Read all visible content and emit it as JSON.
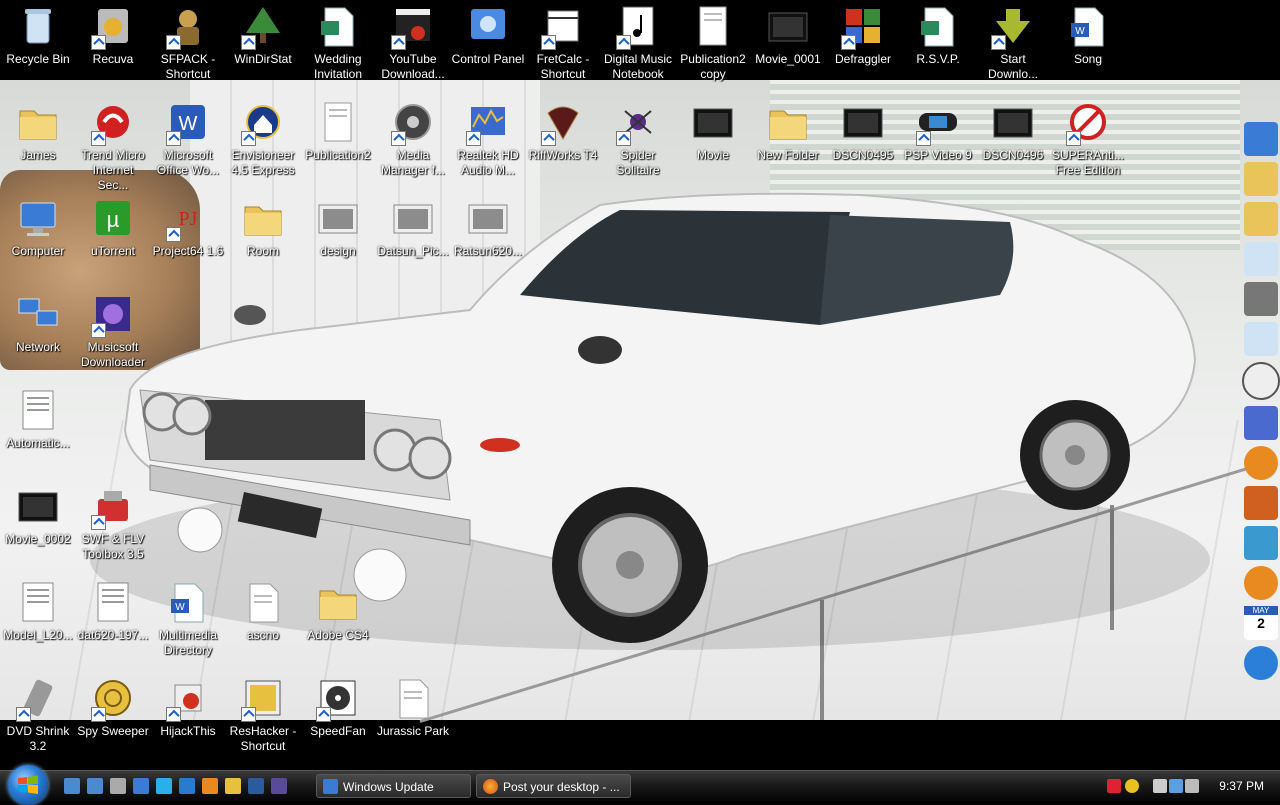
{
  "desktop": {
    "icons": [
      {
        "label": "Recycle Bin",
        "icon": "recycle-bin-icon",
        "shortcut": false
      },
      {
        "label": "Recuva",
        "icon": "recuva-icon",
        "shortcut": true
      },
      {
        "label": "SFPACK - Shortcut",
        "icon": "sfpack-icon",
        "shortcut": true
      },
      {
        "label": "WinDirStat",
        "icon": "windirstat-icon",
        "shortcut": true
      },
      {
        "label": "Wedding Invitation",
        "icon": "publisher-document-icon",
        "shortcut": false
      },
      {
        "label": "YouTube Download...",
        "icon": "youtube-downloader-icon",
        "shortcut": true
      },
      {
        "label": "Control Panel",
        "icon": "control-panel-icon",
        "shortcut": false
      },
      {
        "label": "FretCalc - Shortcut",
        "icon": "fretcalc-icon",
        "shortcut": true
      },
      {
        "label": "Digital Music Notebook",
        "icon": "music-notebook-icon",
        "shortcut": true
      },
      {
        "label": "Publication2 copy",
        "icon": "publication-icon",
        "shortcut": false
      },
      {
        "label": "Movie_0001",
        "icon": "video-file-icon",
        "shortcut": false
      },
      {
        "label": "Defraggler",
        "icon": "defraggler-icon",
        "shortcut": true
      },
      {
        "label": "R.S.V.P.",
        "icon": "publisher-document-icon",
        "shortcut": false
      },
      {
        "label": "Start Downlo...",
        "icon": "start-download-icon",
        "shortcut": true
      },
      {
        "label": "Song",
        "icon": "word-document-icon",
        "shortcut": false
      },
      {
        "label": "James",
        "icon": "folder-icon",
        "shortcut": false
      },
      {
        "label": "Trend Micro Internet Sec...",
        "icon": "trend-micro-icon",
        "shortcut": true
      },
      {
        "label": "Microsoft Office Wo...",
        "icon": "ms-word-icon",
        "shortcut": true
      },
      {
        "label": "Envisioneer 4.5 Express",
        "icon": "envisioneer-icon",
        "shortcut": true
      },
      {
        "label": "Publication2",
        "icon": "publication-icon",
        "shortcut": false
      },
      {
        "label": "Media Manager f...",
        "icon": "media-manager-icon",
        "shortcut": true
      },
      {
        "label": "Realtek HD Audio M...",
        "icon": "realtek-audio-icon",
        "shortcut": true
      },
      {
        "label": "RiffWorks T4",
        "icon": "riffworks-icon",
        "shortcut": true
      },
      {
        "label": "Spider Solitaire",
        "icon": "spider-solitaire-icon",
        "shortcut": true
      },
      {
        "label": "Movie",
        "icon": "video-file-icon",
        "shortcut": false
      },
      {
        "label": "New Folder",
        "icon": "folder-icon",
        "shortcut": false
      },
      {
        "label": "DSCN0495",
        "icon": "video-file-icon",
        "shortcut": false
      },
      {
        "label": "PSP Video 9",
        "icon": "psp-video-icon",
        "shortcut": true
      },
      {
        "label": "DSCN0496",
        "icon": "video-file-icon",
        "shortcut": false
      },
      {
        "label": "SUPERAnti... Free Edition",
        "icon": "superantispyware-icon",
        "shortcut": true
      },
      {
        "label": "Computer",
        "icon": "computer-icon",
        "shortcut": false
      },
      {
        "label": "uTorrent",
        "icon": "utorrent-icon",
        "shortcut": false
      },
      {
        "label": "Project64 1.6",
        "icon": "project64-icon",
        "shortcut": true
      },
      {
        "label": "Room",
        "icon": "folder-icon",
        "shortcut": false
      },
      {
        "label": "design",
        "icon": "image-file-icon",
        "shortcut": false
      },
      {
        "label": "Datsun_Pic...",
        "icon": "image-file-icon",
        "shortcut": false
      },
      {
        "label": "Ratsun620...",
        "icon": "image-file-icon",
        "shortcut": false
      },
      {
        "label": "Network",
        "icon": "network-icon",
        "shortcut": false
      },
      {
        "label": "Musicsoft Downloader",
        "icon": "musicsoft-icon",
        "shortcut": true
      },
      {
        "label": "Automatic...",
        "icon": "document-icon",
        "shortcut": false
      },
      {
        "label": "Movie_0002",
        "icon": "video-file-icon",
        "shortcut": false
      },
      {
        "label": "SWF & FLV Toolbox 3.5",
        "icon": "swf-toolbox-icon",
        "shortcut": true
      },
      {
        "label": "Model_L20...",
        "icon": "document-icon",
        "shortcut": false
      },
      {
        "label": "dat620-197...",
        "icon": "document-icon",
        "shortcut": false
      },
      {
        "label": "Multimedia Directory",
        "icon": "word-document-icon",
        "shortcut": false
      },
      {
        "label": "ascno",
        "icon": "text-file-icon",
        "shortcut": false
      },
      {
        "label": "Adobe CS4",
        "icon": "folder-icon",
        "shortcut": false
      },
      {
        "label": "DVD Shrink 3.2",
        "icon": "dvd-shrink-icon",
        "shortcut": true
      },
      {
        "label": "Spy Sweeper",
        "icon": "spy-sweeper-icon",
        "shortcut": true
      },
      {
        "label": "HijackThis",
        "icon": "hijackthis-icon",
        "shortcut": true
      },
      {
        "label": "ResHacker - Shortcut",
        "icon": "reshacker-icon",
        "shortcut": true
      },
      {
        "label": "SpeedFan",
        "icon": "speedfan-icon",
        "shortcut": true
      },
      {
        "label": "Jurassic Park",
        "icon": "text-file-icon",
        "shortcut": false
      }
    ]
  },
  "sidebar": {
    "gadgets": [
      "monitor-icon",
      "folder-icon",
      "folder-icon",
      "document-icon",
      "camera-icon",
      "document-icon",
      "clock-icon",
      "paint-icon",
      "fl-studio-icon",
      "flash-icon",
      "media-player-icon",
      "firefox-icon",
      "calendar-icon",
      "windows-orb-icon"
    ],
    "calendar_month": "MAY",
    "calendar_day": "2"
  },
  "taskbar": {
    "start": "windows-orb-icon",
    "quick_launch": [
      "show-desktop-icon",
      "switch-windows-icon",
      "calculator-icon",
      "network-icon",
      "skype-icon",
      "internet-explorer-icon",
      "firefox-icon",
      "media-player-icon",
      "photoshop-icon",
      "after-effects-icon"
    ],
    "windows": [
      {
        "label": "Windows Update",
        "icon": "windows-update-icon"
      },
      {
        "label": "Post your desktop - ...",
        "icon": "firefox-icon"
      }
    ],
    "tray_icons": [
      "ati-icon",
      "network-tray-icon",
      "usb-icon",
      "monitor-tray-icon",
      "volume-icon"
    ],
    "clock": "9:37 PM"
  },
  "colors": {
    "taskbar": "#1b1b1b",
    "accent": "#2c7fd8"
  }
}
